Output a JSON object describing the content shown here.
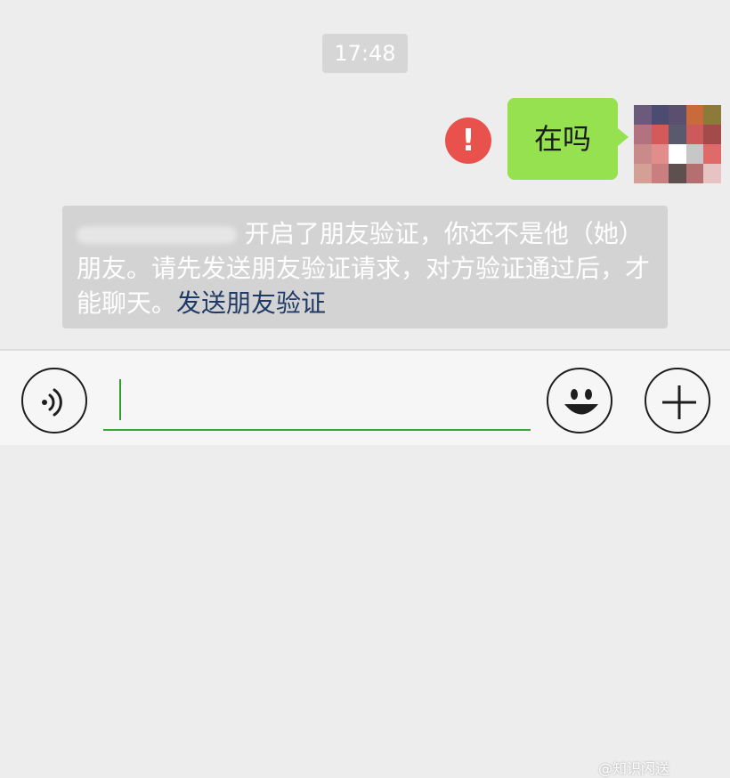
{
  "chat": {
    "timestamp": "17:48",
    "message": {
      "text": "在吗",
      "status_icon": "exclamation-icon",
      "bubble_color": "#95e14f",
      "status_color": "#e9514d"
    },
    "system_notice": {
      "text_part1": "开启了朋友验证，你还不是他（她）朋友。请先发送朋友验证请求，对方验证通过后，才能聊天。",
      "link_label": "发送朋友验证",
      "link_color": "#1f3a66"
    }
  },
  "input_bar": {
    "voice_icon": "voice-icon",
    "emoji_icon": "smiley-icon",
    "plus_icon": "plus-icon",
    "input_value": ""
  },
  "watermark": {
    "text": "@知识闪送"
  }
}
